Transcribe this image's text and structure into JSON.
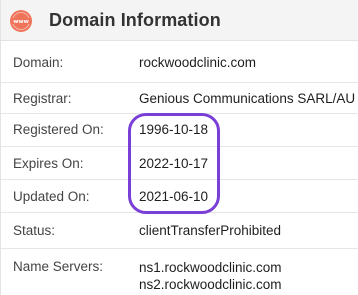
{
  "header": {
    "icon": "www-globe-icon",
    "icon_text": "www",
    "icon_color": "#f0745a",
    "title": "Domain Information"
  },
  "rows": [
    {
      "label": "Domain:",
      "value": "rockwoodclinic.com"
    },
    {
      "label": "Registrar:",
      "value": "Genious Communications SARL/AU"
    },
    {
      "label": "Registered On:",
      "value": "1996-10-18"
    },
    {
      "label": "Expires On:",
      "value": "2022-10-17"
    },
    {
      "label": "Updated On:",
      "value": "2021-06-10"
    },
    {
      "label": "Status:",
      "value": "clientTransferProhibited"
    },
    {
      "label": "Name Servers:",
      "values": [
        "ns1.rockwoodclinic.com",
        "ns2.rockwoodclinic.com"
      ]
    }
  ],
  "highlight_color": "#7a3fd6"
}
